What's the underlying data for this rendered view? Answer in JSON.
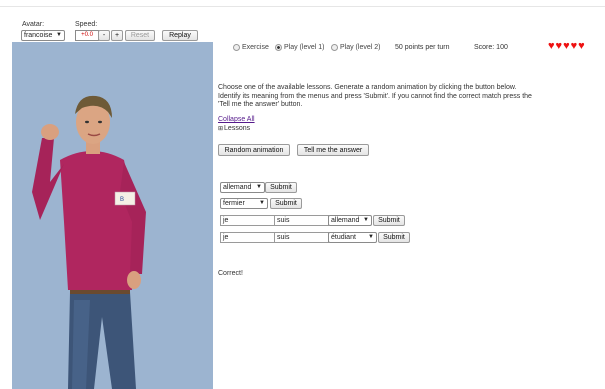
{
  "toolbar": {
    "avatar_label": "Avatar:",
    "avatar_value": "francoise",
    "speed_label": "Speed:",
    "speed_value": "+0.0",
    "minus_label": "-",
    "plus_label": "+",
    "reset_label": "Reset",
    "replay_label": "Replay"
  },
  "modes": {
    "exercise": "Exercise",
    "play1": "Play (level 1)",
    "play2": "Play (level 2)",
    "selected": "play1"
  },
  "points_per_turn": "50 points per turn",
  "score": "Score: 100",
  "hearts": 5,
  "badge_text": "B",
  "instructions": "Choose one of the available lessons. Generate a random animation by clicking the button below. Identify its meaning from the menus and press 'Submit'. If you cannot find the correct match press the 'Tell me the answer' button.",
  "collapse_all": "Collapse All",
  "lessons_label": "Lessons",
  "random_button": "Random animation",
  "tell_button": "Tell me the answer",
  "rows": {
    "r1": {
      "select": "allemand",
      "submit": "Submit"
    },
    "r2": {
      "select": "fermier",
      "submit": "Submit"
    },
    "r3": {
      "word1": "je",
      "word2": "suis",
      "select": "allemand",
      "submit": "Submit"
    },
    "r4": {
      "word1": "je",
      "word2": "suis",
      "select": "étudiant",
      "submit": "Submit"
    }
  },
  "result": "Correct!",
  "colors": {
    "panel_bg": "#9cb4d0",
    "heart": "#ee1111",
    "shirt": "#b0265f"
  }
}
